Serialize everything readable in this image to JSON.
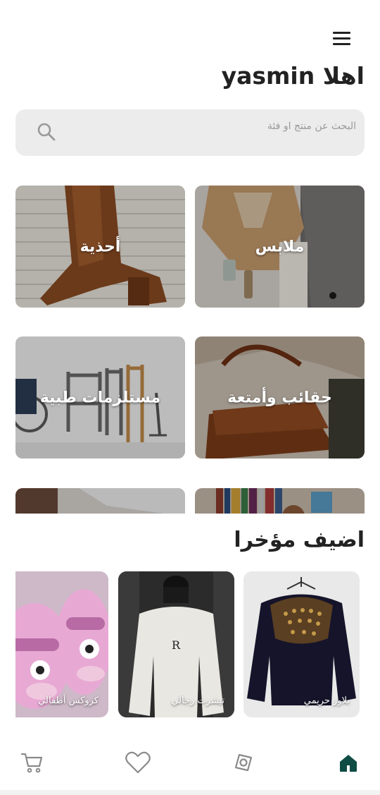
{
  "header": {
    "menu_icon": "hamburger-menu-icon",
    "greeting": "اهلا yasmin"
  },
  "search": {
    "placeholder": "البحث عن منتج او فئة",
    "icon": "search-icon"
  },
  "categories": [
    {
      "label": "ملابس"
    },
    {
      "label": "أحذية"
    },
    {
      "label": "حقائب وأمتعة"
    },
    {
      "label": "مستلزمات طبية"
    },
    {
      "label": ""
    },
    {
      "label": ""
    }
  ],
  "recent": {
    "title": "اضيف مؤخرا",
    "products": [
      {
        "name": "بلاوز حريمي"
      },
      {
        "name": "تيشرت رجالي"
      },
      {
        "name": "كروكس أطفالي"
      }
    ]
  },
  "bottom_nav": {
    "items": [
      {
        "icon": "home-icon",
        "active": true
      },
      {
        "icon": "explore-icon",
        "active": false
      },
      {
        "icon": "heart-icon",
        "active": false
      },
      {
        "icon": "cart-icon",
        "active": false
      }
    ]
  },
  "colors": {
    "accent": "#0f4c45",
    "search_bg": "#ececec",
    "icon_gray": "#8a8a8a"
  }
}
